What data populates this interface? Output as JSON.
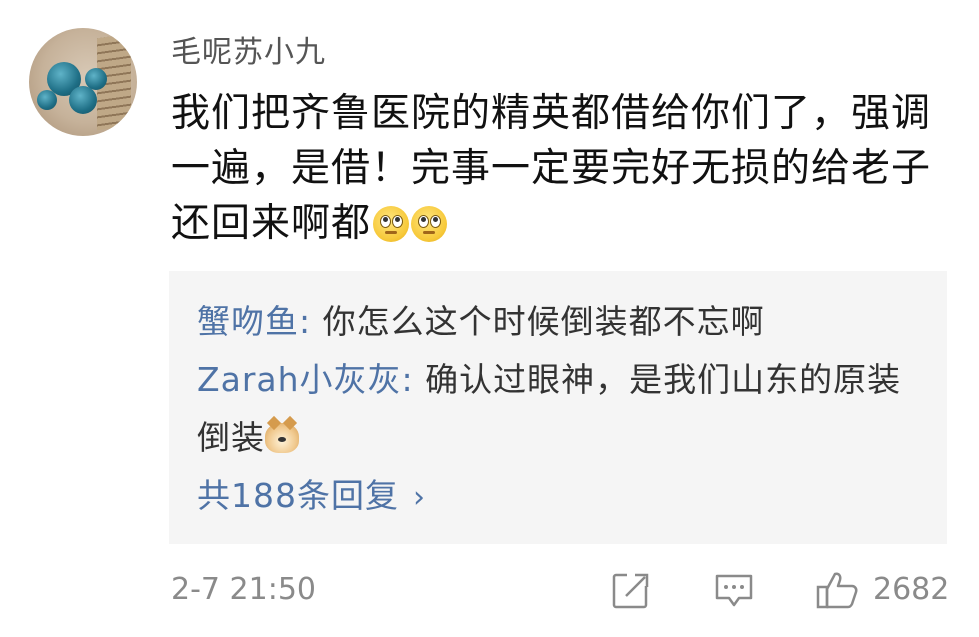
{
  "comment": {
    "username": "毛呢苏小九",
    "text_line1": "我们把齐鲁医院的精英都借给你们了，强调",
    "text_line2": "一遍，是借！完事一定要完好无损的给老子",
    "text_line3": "还回来啊都",
    "emoji_names": [
      "eye-roll-emoji",
      "eye-roll-emoji"
    ]
  },
  "replies": [
    {
      "name": "蟹吻鱼",
      "separator": ": ",
      "text": "你怎么这个时候倒装都不忘啊"
    },
    {
      "name": "Zarah小灰灰",
      "separator": ": ",
      "text_line1": "确认过眼神，是我们山东的原装",
      "text_line2": "倒装",
      "emoji_name": "doge-emoji"
    }
  ],
  "more_replies": {
    "label": "共188条回复",
    "chevron": "›"
  },
  "footer": {
    "time": "2-7 21:50",
    "like_count": "2682",
    "icons": [
      "share-icon",
      "comment-icon",
      "like-icon"
    ]
  },
  "colors": {
    "link_blue": "#4f73a6",
    "reply_bg": "#f5f5f5",
    "meta_gray": "#8a8a8a"
  }
}
